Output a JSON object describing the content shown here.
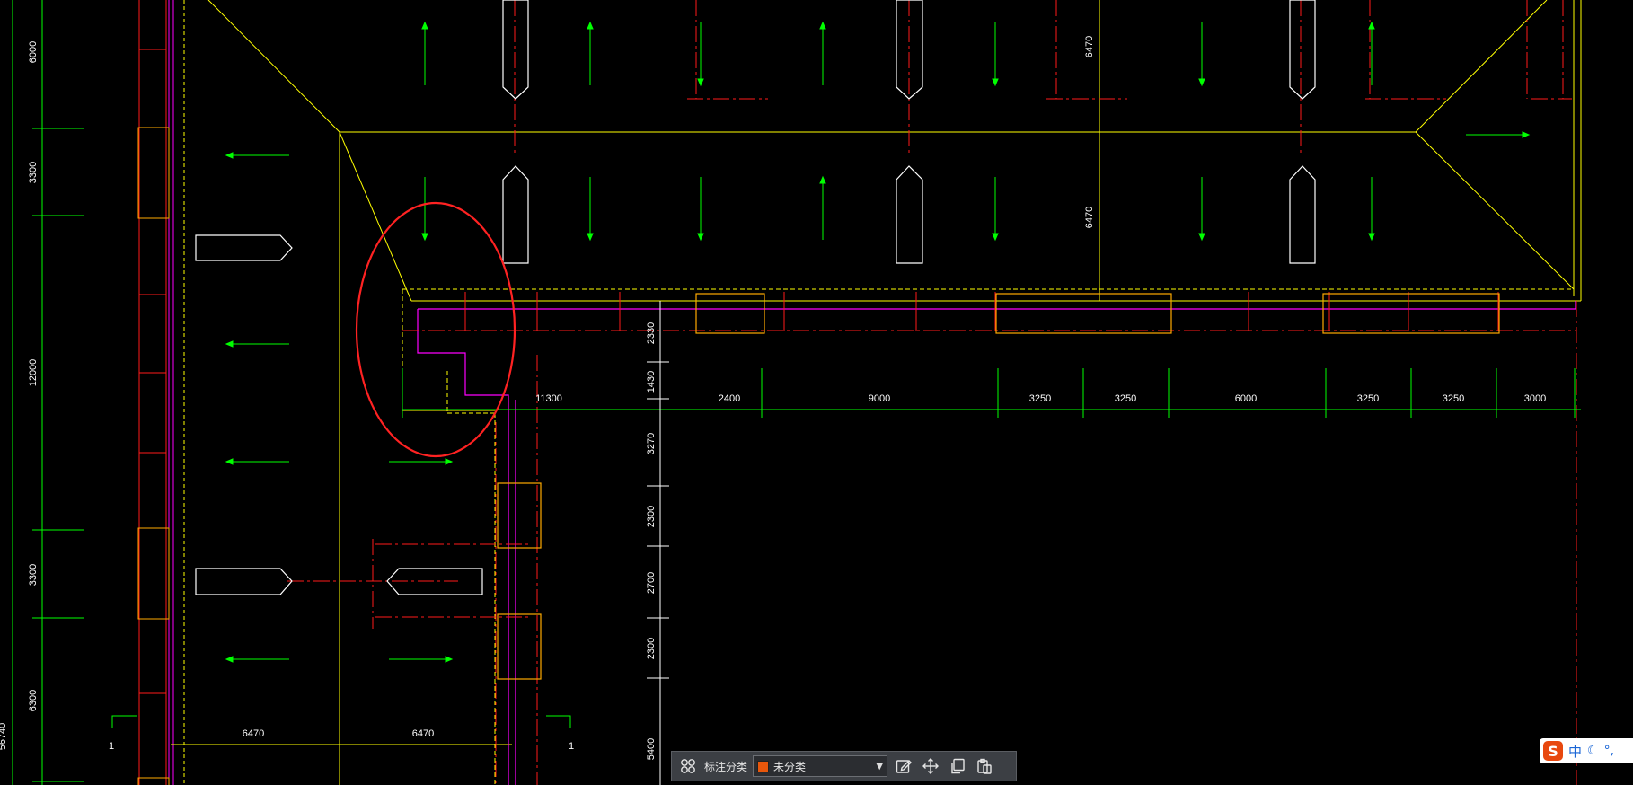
{
  "colors": {
    "background": "#000000",
    "axis_red": "#ff1a1a",
    "grid_green": "#00ff00",
    "wall_yellow": "#ffff00",
    "magenta": "#ff00ff",
    "white": "#ffffff",
    "orange": "#ffaa00",
    "annotation_circle": "#ff2222",
    "category_swatch": "#e8570c"
  },
  "dimensions": {
    "top_row": [
      "11300",
      "2400",
      "9000",
      "3250",
      "3250",
      "6000",
      "3250",
      "3250",
      "3000"
    ],
    "left_column": [
      "6000",
      "3300",
      "12000",
      "3300",
      "6300"
    ],
    "left_edge_partial": "56740",
    "inner_vertical": [
      "2330",
      "1430",
      "3270",
      "2300",
      "2700",
      "2300",
      "5400"
    ],
    "bottom_row": [
      "6470",
      "6470"
    ],
    "ramp_vertical": [
      "6470",
      "6470"
    ],
    "section_marks": [
      "1",
      "1"
    ]
  },
  "toolbar": {
    "grid_icon": "grid-icon",
    "label": "标注分类",
    "category_value": "未分类",
    "dropdown_icon": "caret-down-icon",
    "icons": [
      "edit-icon",
      "move-icon",
      "copy-icon",
      "paste-icon"
    ]
  },
  "ime": {
    "logo": "S",
    "lang": "中",
    "mode_icon": "moon-icon",
    "punct": "°,"
  }
}
